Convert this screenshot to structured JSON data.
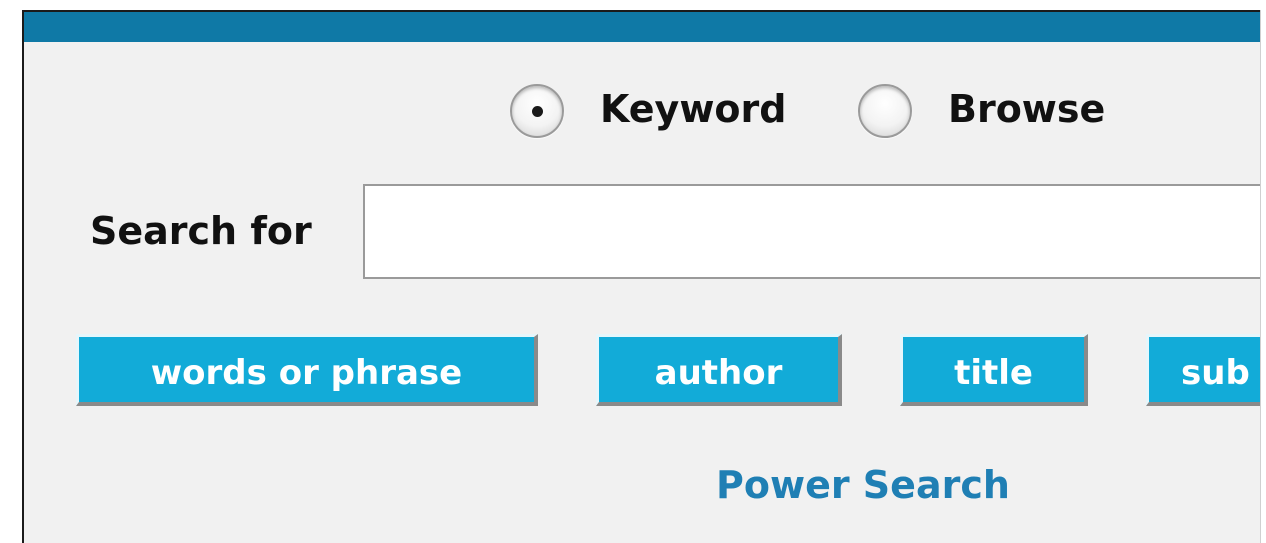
{
  "search_mode": {
    "options": [
      {
        "label": "Keyword",
        "selected": true
      },
      {
        "label": "Browse",
        "selected": false
      }
    ]
  },
  "search": {
    "label": "Search for",
    "value": "",
    "placeholder": ""
  },
  "search_types": {
    "words": "words or phrase",
    "author": "author",
    "title": "title",
    "subject": "sub"
  },
  "links": {
    "power_search": "Power Search"
  },
  "colors": {
    "header_bar": "#0f79a6",
    "button_bg": "#12abd8",
    "button_text": "#ffffff",
    "link": "#1f7fb4",
    "panel_bg": "#f1f1f1"
  }
}
